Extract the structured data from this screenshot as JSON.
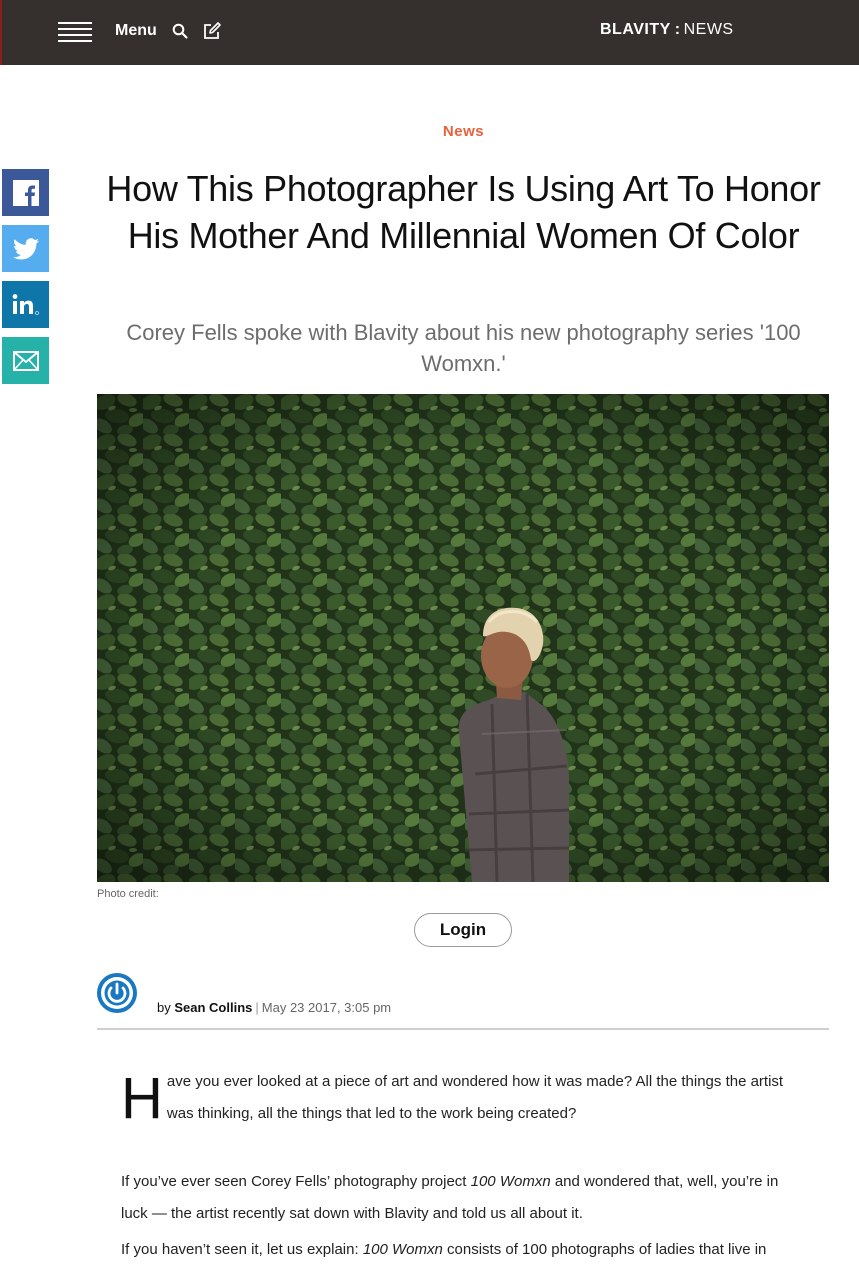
{
  "header": {
    "menu_label": "Menu",
    "logo_brand": "BLAVITY",
    "logo_separator": ":",
    "logo_section": "NEWS"
  },
  "share": {
    "colors": {
      "facebook": "#3b5998",
      "twitter": "#55acee",
      "linkedin": "#0e76a8",
      "email": "#26b2a9"
    }
  },
  "article": {
    "category": "News",
    "title": "How This Photographer Is Using Art To Honor His Mother And Millennial Women Of Color",
    "subtitle": "Corey Fells spoke with Blavity about his new photography series '100 Womxn.'",
    "photo_credit": "Photo credit:",
    "login_label": "Login",
    "byline": {
      "by": "by",
      "author": "Sean Collins",
      "separator": "|",
      "date": "May 23 2017, 3:05 pm"
    },
    "paragraphs": {
      "p1": {
        "dropcap": "H",
        "text": "ave you ever looked at a piece of art and wondered how it was made? All the things the artist was thinking, all the things that led to the work being created?"
      },
      "p2": {
        "before": "If you’ve ever seen Corey Fells’ photography project ",
        "em": "100 Womxn",
        "after": " and wondered that, well, you’re in luck — the artist recently sat down with Blavity and told us all about it."
      },
      "p3": {
        "before": "If you haven’t seen it, let us explain: ",
        "em": "100 Womxn",
        "after": " consists of 100 photographs of ladies that live in"
      }
    }
  },
  "colors": {
    "topbar": "#352f2d",
    "accent": "#e8613c",
    "avatar_blue": "#1a78c2"
  }
}
